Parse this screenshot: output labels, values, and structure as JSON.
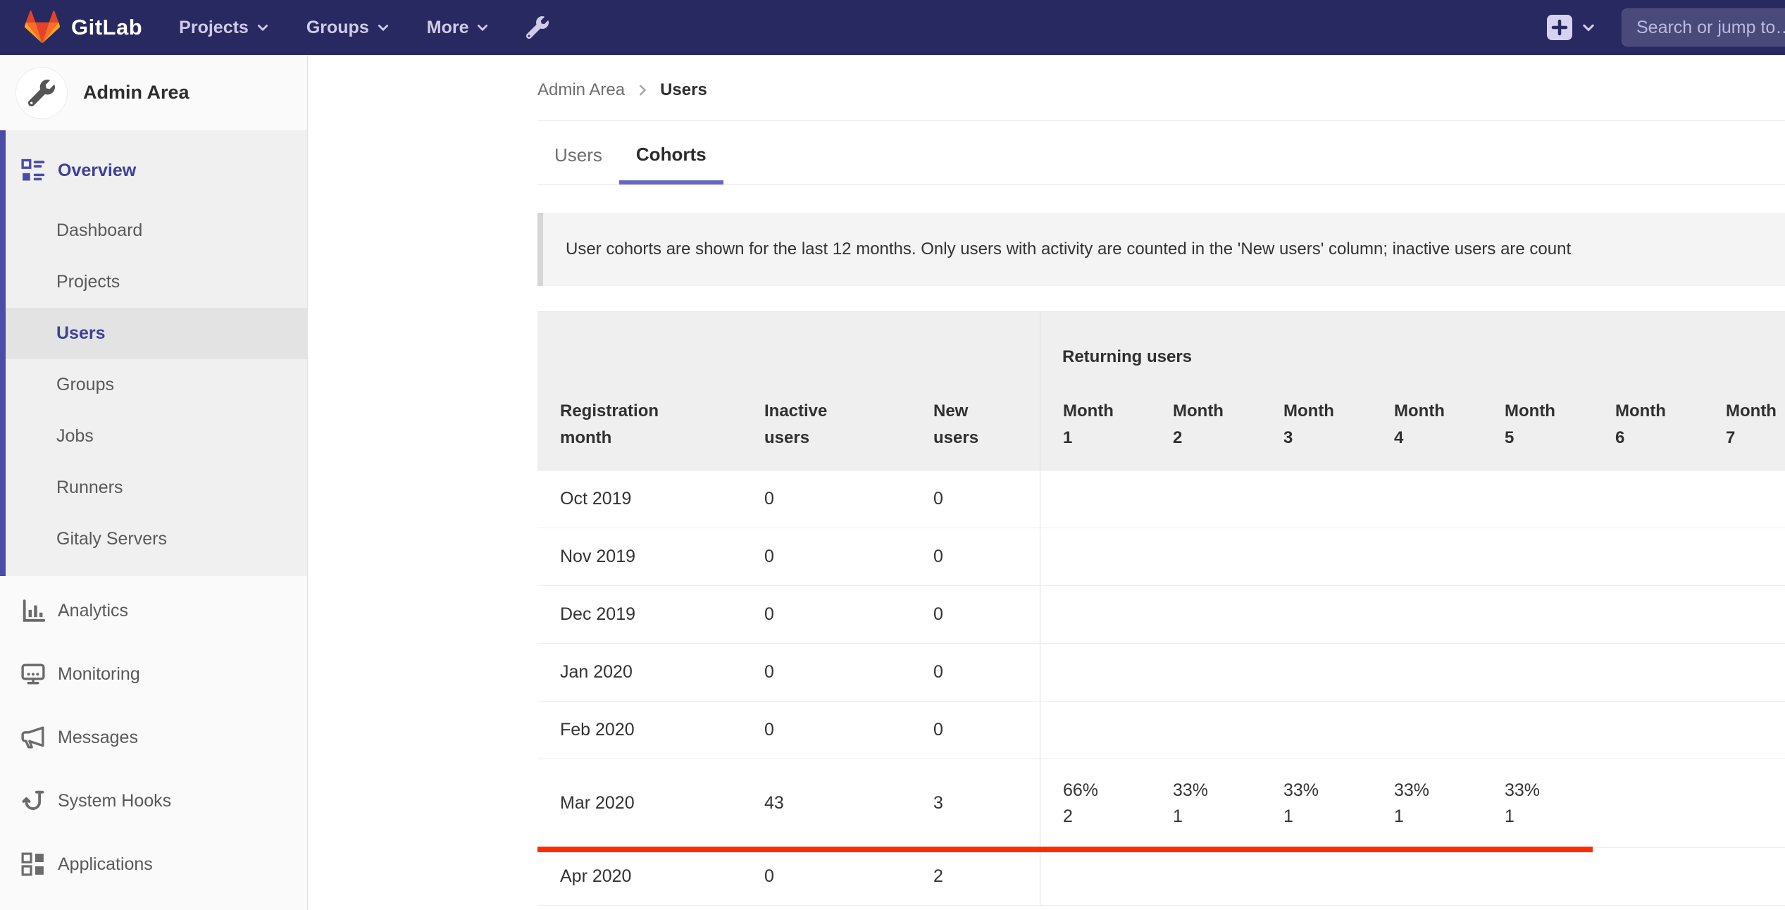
{
  "colors": {
    "navbar_bg": "#292961",
    "indigo": "#4b4ba8",
    "indigo_text": "#403f99",
    "accent": "#6666c4",
    "red_line": "#fb2d00"
  },
  "navbar": {
    "brand": "GitLab",
    "links": [
      {
        "label": "Projects"
      },
      {
        "label": "Groups"
      },
      {
        "label": "More"
      }
    ],
    "search": {
      "placeholder": "Search or jump to…"
    }
  },
  "sidebar": {
    "title": "Admin Area",
    "overview_section": {
      "items": [
        {
          "label": "Overview"
        },
        {
          "label": "Dashboard"
        },
        {
          "label": "Projects"
        },
        {
          "label": "Users",
          "active": true
        },
        {
          "label": "Groups"
        },
        {
          "label": "Jobs"
        },
        {
          "label": "Runners"
        },
        {
          "label": "Gitaly Servers"
        }
      ]
    },
    "bottom_items": [
      {
        "label": "Analytics"
      },
      {
        "label": "Monitoring"
      },
      {
        "label": "Messages"
      },
      {
        "label": "System Hooks"
      },
      {
        "label": "Applications"
      }
    ]
  },
  "breadcrumb": {
    "parent": "Admin Area",
    "current": "Users"
  },
  "tabs": {
    "users": "Users",
    "cohorts": "Cohorts"
  },
  "callout": {
    "text": "User cohorts are shown for the last 12 months. Only users with activity are counted in the 'New users' column; inactive users are count"
  },
  "cohorts_table": {
    "group_header": "Returning users",
    "columns": [
      "Registration\nmonth",
      "Inactive\nusers",
      "New\nusers",
      "Month\n1",
      "Month\n2",
      "Month\n3",
      "Month\n4",
      "Month\n5",
      "Month\n6",
      "Month\n7"
    ],
    "rows": [
      {
        "registration_month": "Oct 2019",
        "inactive_users": "0",
        "new_users": "0",
        "returning": [
          "",
          "",
          "",
          "",
          "",
          "",
          ""
        ]
      },
      {
        "registration_month": "Nov 2019",
        "inactive_users": "0",
        "new_users": "0",
        "returning": [
          "",
          "",
          "",
          "",
          "",
          "",
          ""
        ]
      },
      {
        "registration_month": "Dec 2019",
        "inactive_users": "0",
        "new_users": "0",
        "returning": [
          "",
          "",
          "",
          "",
          "",
          "",
          ""
        ]
      },
      {
        "registration_month": "Jan 2020",
        "inactive_users": "0",
        "new_users": "0",
        "returning": [
          "",
          "",
          "",
          "",
          "",
          "",
          ""
        ]
      },
      {
        "registration_month": "Feb 2020",
        "inactive_users": "0",
        "new_users": "0",
        "returning": [
          "",
          "",
          "",
          "",
          "",
          "",
          ""
        ]
      },
      {
        "registration_month": "Mar 2020",
        "inactive_users": "43",
        "new_users": "3",
        "returning": [
          "66%\n2",
          "33%\n1",
          "33%\n1",
          "33%\n1",
          "33%\n1",
          "",
          ""
        ]
      },
      {
        "registration_month": "Apr 2020",
        "inactive_users": "0",
        "new_users": "2",
        "returning": [
          "",
          "",
          "",
          "",
          "",
          "",
          ""
        ]
      }
    ]
  }
}
